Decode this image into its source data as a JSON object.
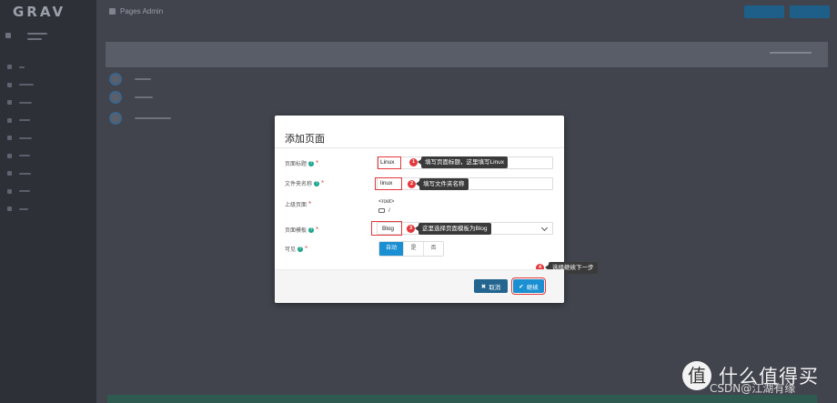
{
  "app": {
    "logo": "GRAV",
    "page_title": "Pages Admin"
  },
  "modal": {
    "title": "添加页面",
    "fields": {
      "page_title": {
        "label": "页面标题",
        "value": "Linux"
      },
      "folder_name": {
        "label": "文件夹名称",
        "value": "linux"
      },
      "parent": {
        "label": "上级页面",
        "root": "<root>",
        "path": "/"
      },
      "template": {
        "label": "页面模板",
        "value": "Blog"
      },
      "visible": {
        "label": "可见",
        "options": [
          "自动",
          "是",
          "否"
        ],
        "selected": "自动"
      }
    },
    "help_glyph": "?",
    "required_glyph": "*",
    "buttons": {
      "cancel": "取消",
      "continue": "继续",
      "cancel_icon": "✖",
      "continue_icon": "✔"
    }
  },
  "annotations": [
    {
      "num": "1",
      "text": "填写页面标题，这里填写Linux"
    },
    {
      "num": "2",
      "text": "填写文件夹名称"
    },
    {
      "num": "3",
      "text": "这里选择页面模板为Blog"
    },
    {
      "num": "4",
      "text": "选择继续下一步"
    }
  ],
  "watermark": {
    "icon": "值",
    "title": "什么值得买",
    "subtitle": "CSDN@江湖有缘"
  },
  "colors": {
    "accent": "#1a8fd1",
    "annotation_red": "#e5383b",
    "help_green": "#19a58c",
    "backdrop": "#3c404b"
  }
}
